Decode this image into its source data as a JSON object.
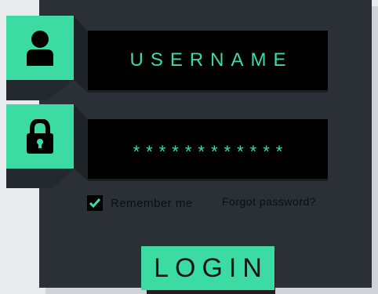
{
  "theme": {
    "accent": "#3ddba4",
    "panel": "#2a3036",
    "field_bg": "#000000",
    "page_bg": "#e8eaee"
  },
  "form": {
    "username_value": "USERNAME",
    "password_value": "************",
    "remember_checked": true,
    "remember_label": "Remember me",
    "forgot_label": "Forgot password?",
    "login_label": "LOGIN"
  },
  "icons": {
    "username": "user-icon",
    "password": "lock-icon",
    "checkbox": "checkmark-icon"
  }
}
